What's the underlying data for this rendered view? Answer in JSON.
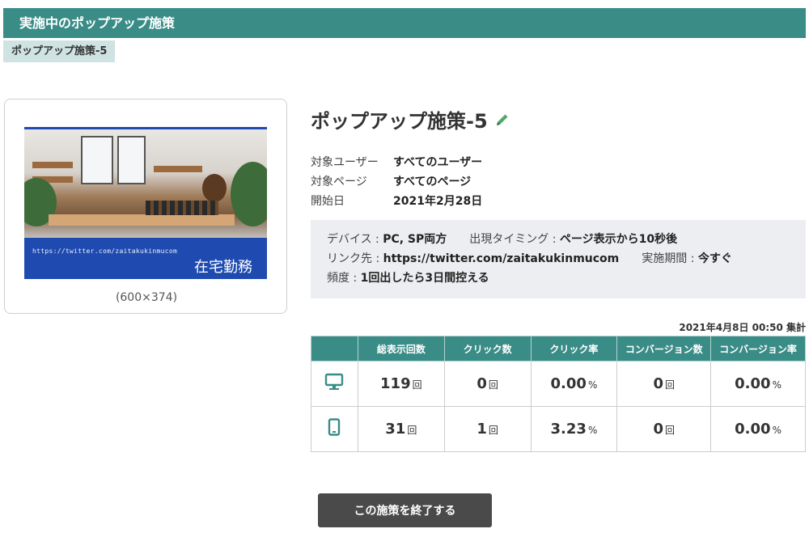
{
  "header": {
    "title": "実施中のポップアップ施策"
  },
  "tab": {
    "label": "ポップアップ施策-5"
  },
  "preview": {
    "banner_url": "https://twitter.com/zaitakukinmucom",
    "banner_title": "在宅勤務",
    "size_label": "(600×374)"
  },
  "campaign": {
    "title": "ポップアップ施策-5",
    "edit_icon": "pencil-icon",
    "target_user_label": "対象ユーザー",
    "target_user_value": "すべてのユーザー",
    "target_page_label": "対象ページ",
    "target_page_value": "すべてのページ",
    "start_date_label": "開始日",
    "start_date_value": "2021年2月28日"
  },
  "details": {
    "device_label": "デバイス : ",
    "device_value": "PC, SP両方",
    "timing_label": "出現タイミング : ",
    "timing_value": "ページ表示から10秒後",
    "link_label": "リンク先 : ",
    "link_value": "https://twitter.com/zaitakukinmucom",
    "period_label": "実施期間 : ",
    "period_value": "今すぐ",
    "frequency_label": "頻度 : ",
    "frequency_value": "1回出したら3日間控える"
  },
  "aggregation": "2021年4月8日 00:50 集計",
  "stats": {
    "headers": [
      "",
      "総表示回数",
      "クリック数",
      "クリック率",
      "コンバージョン数",
      "コンバージョン率"
    ],
    "rows": [
      {
        "device_icon": "desktop-icon",
        "impressions": "119",
        "clicks": "0",
        "ctr": "0.00",
        "conversions": "0",
        "cvr": "0.00"
      },
      {
        "device_icon": "smartphone-icon",
        "impressions": "31",
        "clicks": "1",
        "ctr": "3.23",
        "conversions": "0",
        "cvr": "0.00"
      }
    ],
    "count_unit": "回",
    "rate_unit": "%"
  },
  "actions": {
    "end_label": "この施策を終了する"
  },
  "colors": {
    "accent": "#3a8c87",
    "tab_bg": "#cfe3e2",
    "banner_blue": "#1f4bb0",
    "button_dark": "#4a4a4a"
  }
}
